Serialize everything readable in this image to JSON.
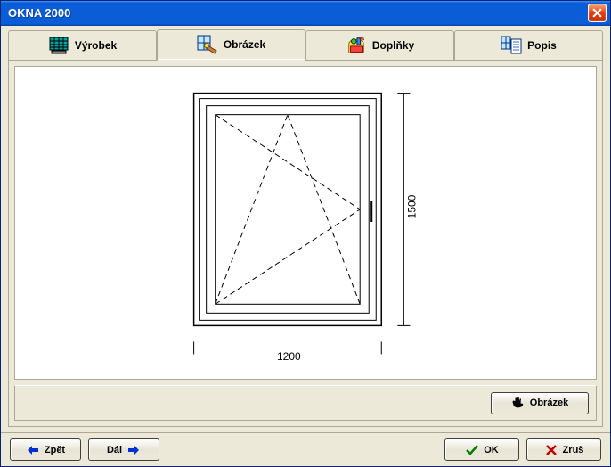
{
  "window": {
    "title": "OKNA 2000"
  },
  "tabs": {
    "product": "Výrobek",
    "image": "Obrázek",
    "accessories": "Doplňky",
    "description": "Popis"
  },
  "drawing": {
    "width_label": "1200",
    "height_label": "1500"
  },
  "panel": {
    "image_button": "Obrázek"
  },
  "bottom": {
    "back": "Zpět",
    "next": "Dál",
    "ok": "OK",
    "cancel": "Zruš"
  }
}
